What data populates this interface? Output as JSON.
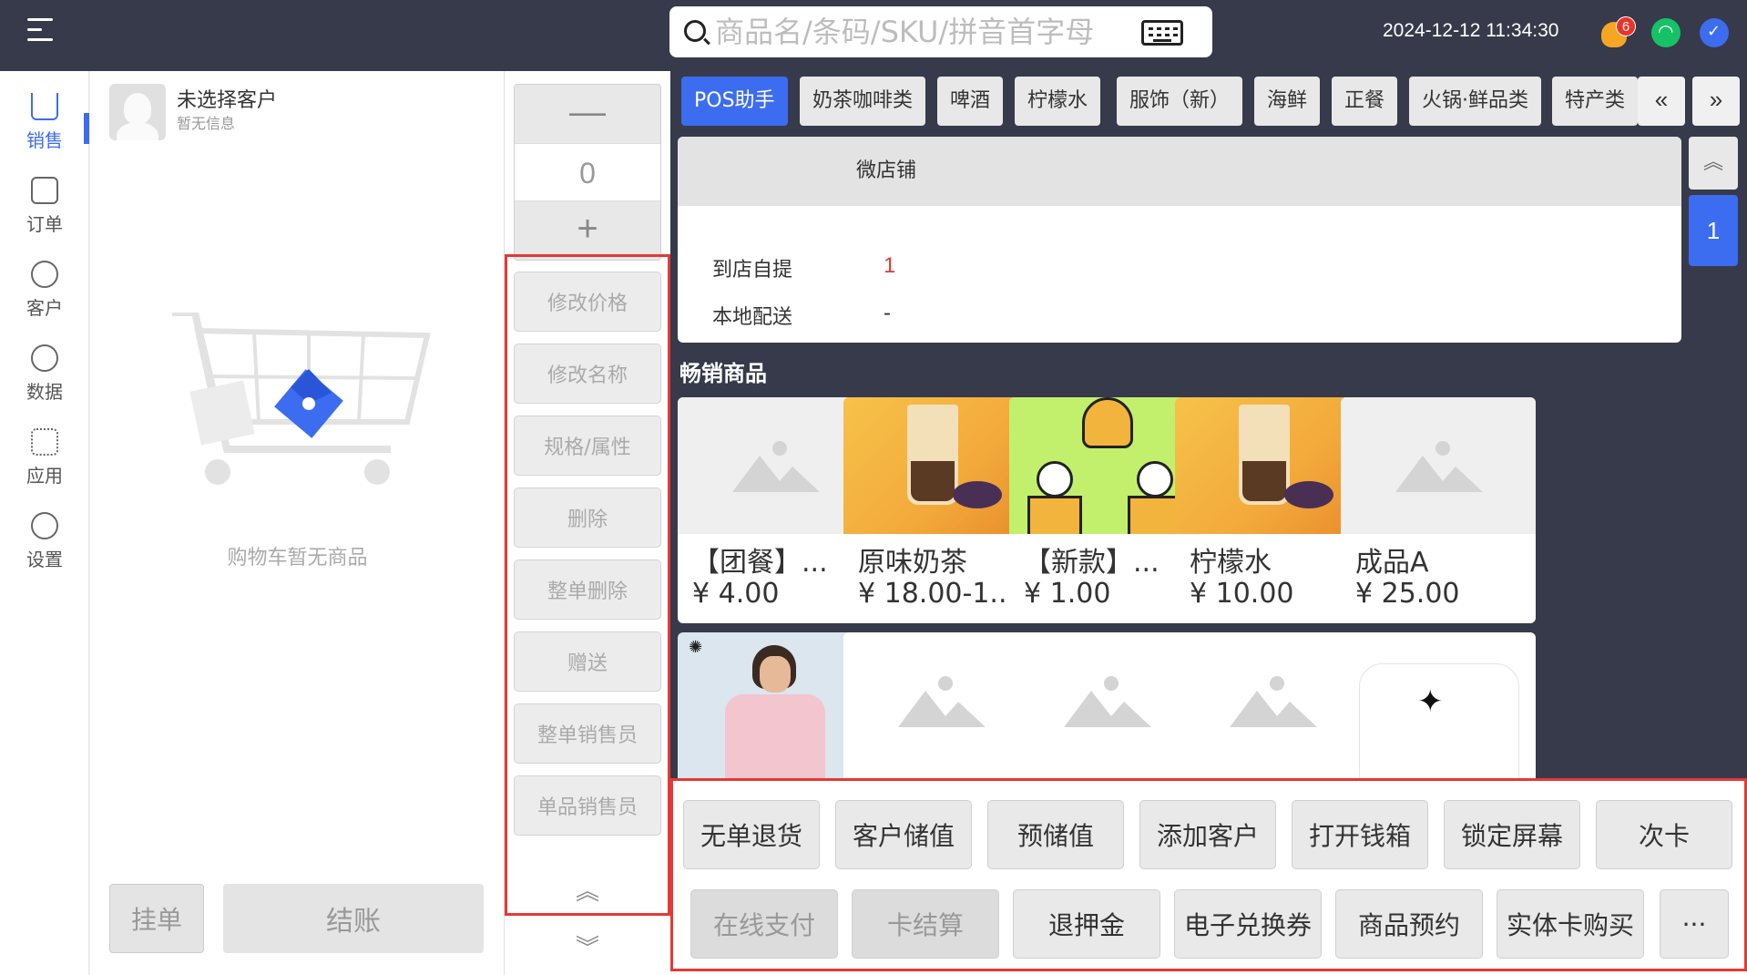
{
  "topbar": {
    "search_placeholder": "商品名/条码/SKU/拼音首字母",
    "datetime": "2024-12-12 11:34:30",
    "notification_count": "6"
  },
  "sidenav": {
    "items": [
      {
        "label": "销售",
        "icon": "cart-icon"
      },
      {
        "label": "订单",
        "icon": "clipboard-icon"
      },
      {
        "label": "客户",
        "icon": "users-icon"
      },
      {
        "label": "数据",
        "icon": "user-data-icon"
      },
      {
        "label": "应用",
        "icon": "apps-icon"
      },
      {
        "label": "设置",
        "icon": "gear-icon"
      }
    ]
  },
  "cart": {
    "customer_name": "未选择客户",
    "customer_info": "暂无信息",
    "empty_text": "购物车暂无商品",
    "hold_label": "挂单",
    "checkout_label": "结账"
  },
  "ops": {
    "qty_minus": "—",
    "qty_value": "0",
    "qty_plus": "+",
    "buttons": [
      "修改价格",
      "修改名称",
      "规格/属性",
      "删除",
      "整单删除",
      "赠送",
      "整单销售员",
      "单品销售员"
    ],
    "chevron_up": "︽",
    "chevron_down": "︾"
  },
  "tabs": [
    "POS助手",
    "奶茶咖啡类",
    "啤酒",
    "柠檬水",
    "服饰（新）",
    "海鲜",
    "正餐",
    "火锅·鲜品类",
    "特产类"
  ],
  "tab_prev": "«",
  "tab_next": "»",
  "store": {
    "header": "微店铺",
    "rows": [
      {
        "label": "到店自提",
        "value": "1"
      },
      {
        "label": "本地配送",
        "value": "-"
      }
    ]
  },
  "pagination": {
    "up": "︽",
    "current": "1"
  },
  "section_title": "畅销商品",
  "products": [
    {
      "name": "【团餐】...",
      "price": "¥ 4.00"
    },
    {
      "name": "原味奶茶",
      "price": "¥ 18.00-1..."
    },
    {
      "name": "【新款】...",
      "price": "¥ 1.00"
    },
    {
      "name": "柠檬水",
      "price": "¥ 10.00"
    },
    {
      "name": "成品A",
      "price": "¥ 25.00"
    }
  ],
  "actions_row1": [
    "无单退货",
    "客户储值",
    "预储值",
    "添加客户",
    "打开钱箱",
    "锁定屏幕",
    "次卡"
  ],
  "actions_row2": [
    "在线支付",
    "卡结算",
    "退押金",
    "电子兑换券",
    "商品预约",
    "实体卡购买",
    "···"
  ],
  "colors": {
    "accent": "#3c6cf0",
    "topbar": "#363a4a",
    "highlight_border": "#e53935"
  }
}
